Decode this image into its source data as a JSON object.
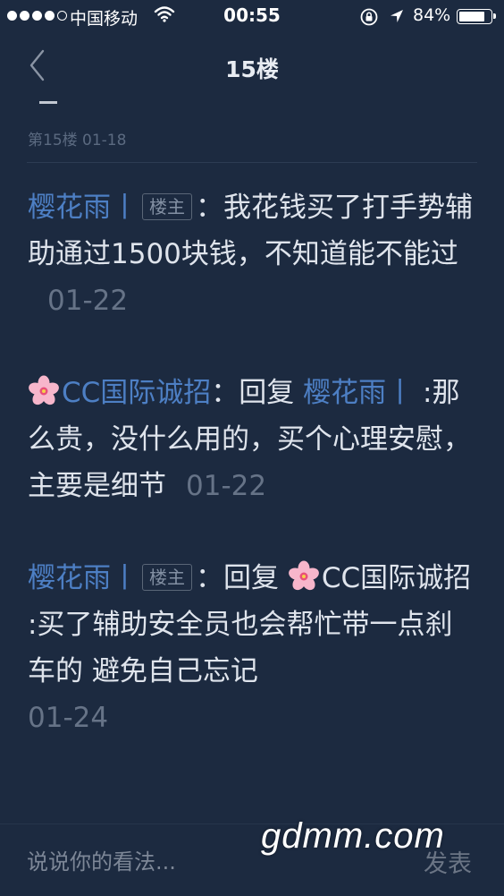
{
  "status_bar": {
    "carrier": "中国移动",
    "time": "00:55",
    "battery": "84%",
    "battery_level": 0.84,
    "signal_bars_filled": 4,
    "signal_bars_total": 5
  },
  "nav": {
    "title": "15楼"
  },
  "floor": {
    "meta": "第15楼  01-18"
  },
  "replies": [
    {
      "author": "樱花雨丨",
      "tag": "楼主",
      "separator": "：",
      "text": "我花钱买了打手势辅助通过1500块钱，不知道能不能过",
      "date": "01-22"
    },
    {
      "author": "CC国际诚招",
      "author_icon": "cherry-blossom-icon",
      "separator": "：",
      "reply_prefix": "回复 ",
      "reply_to": "樱花雨丨",
      "text": " :那么贵，没什么用的，买个心理安慰，主要是细节",
      "date": "01-22"
    },
    {
      "author": "樱花雨丨",
      "tag": "楼主",
      "separator": "：",
      "reply_prefix": "回复 ",
      "reply_to": "CC国际诚招",
      "reply_to_icon": "cherry-blossom-icon",
      "text": " :买了辅助安全员也会帮忙带一点刹车的 避免自己忘记",
      "date": "01-24"
    }
  ],
  "bottom_bar": {
    "input_placeholder": "说说你的看法...",
    "send_label": "发表"
  },
  "watermark": "gdmm.com",
  "colors": {
    "background": "#1c2a40",
    "author": "#4d7fc4",
    "body_text": "#dfe4ec",
    "date": "#667387"
  }
}
